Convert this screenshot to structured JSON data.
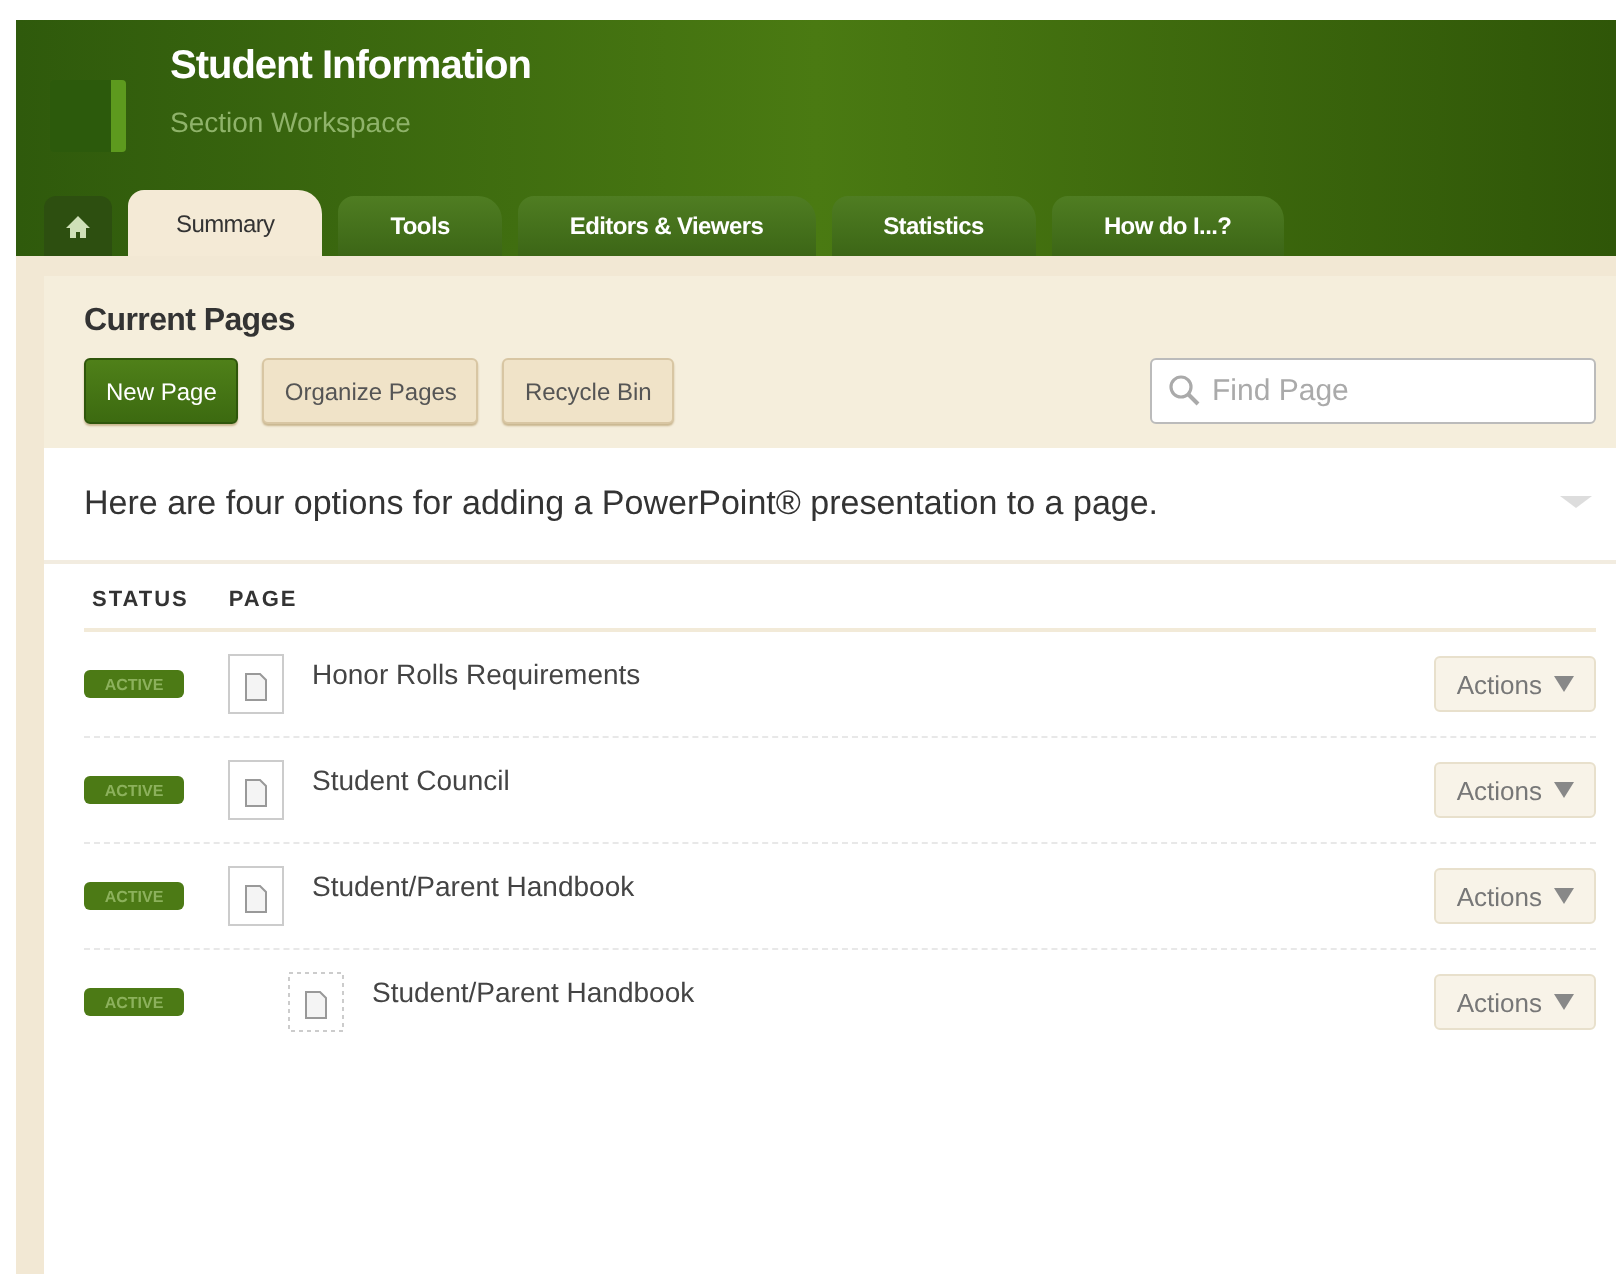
{
  "header": {
    "title": "Student Information",
    "subtitle": "Section Workspace"
  },
  "tabs": [
    {
      "label": "Summary",
      "selected": true
    },
    {
      "label": "Tools",
      "selected": false
    },
    {
      "label": "Editors & Viewers",
      "selected": false
    },
    {
      "label": "Statistics",
      "selected": false
    },
    {
      "label": "How do I...?",
      "selected": false
    }
  ],
  "panel": {
    "title": "Current Pages",
    "buttons": [
      {
        "label": "New Page",
        "kind": "primary"
      },
      {
        "label": "Organize Pages",
        "kind": "secondary"
      },
      {
        "label": "Recycle Bin",
        "kind": "secondary"
      }
    ],
    "search": {
      "placeholder": "Find Page"
    }
  },
  "notice": "Here are four options for adding a PowerPoint® presentation to a page.",
  "table": {
    "columns": [
      "STATUS",
      "PAGE"
    ],
    "rows": [
      {
        "status": "ACTIVE",
        "page": "Honor Rolls Requirements",
        "action": "Actions"
      },
      {
        "status": "ACTIVE",
        "page": "Student Council",
        "action": "Actions"
      },
      {
        "status": "ACTIVE",
        "page": "Student/Parent Handbook",
        "action": "Actions",
        "children": [
          {
            "status": "ACTIVE",
            "page": "Student/Parent Handbook",
            "action": "Actions"
          }
        ]
      }
    ]
  }
}
